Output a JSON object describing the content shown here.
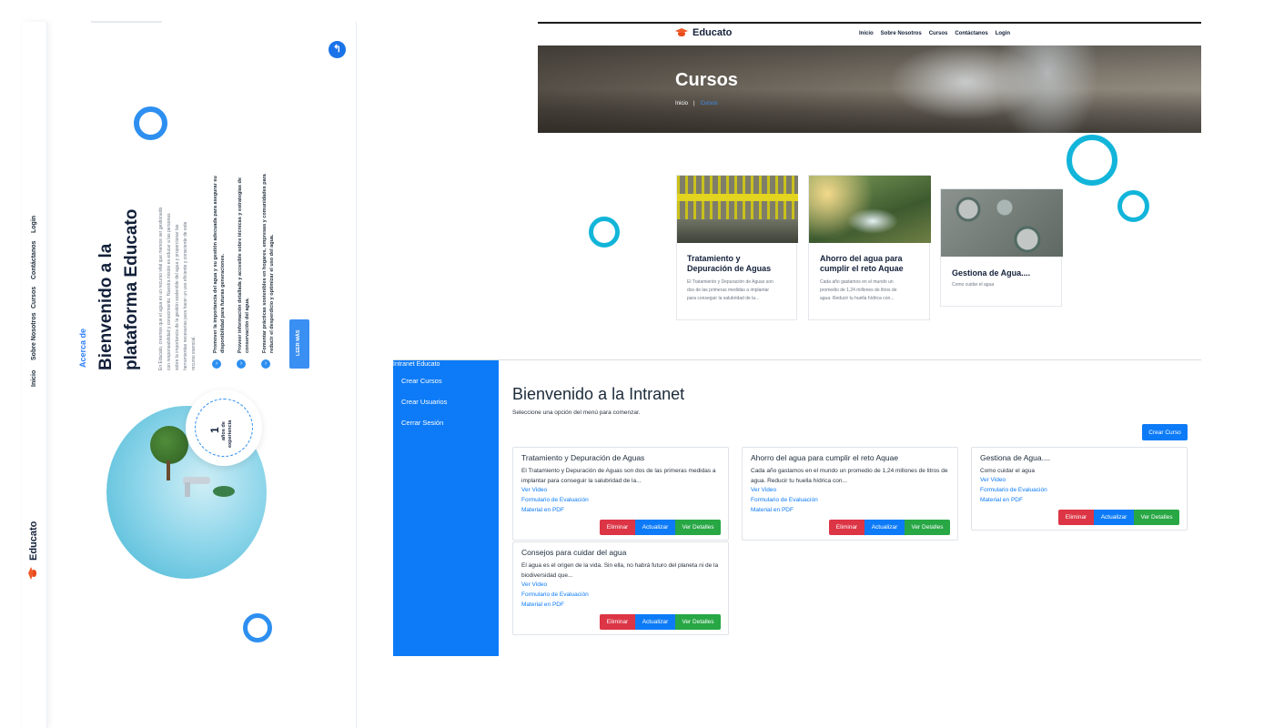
{
  "landing": {
    "nav": [
      "Inicio",
      "Sobre Nosotros",
      "Cursos",
      "Contáctanos",
      "Login"
    ],
    "logo": "Educato",
    "kicker": "Acerca de",
    "title_line1": "Bienvenido a la",
    "title_line2": "plataforma Educato",
    "paragraph": [
      "En Educato, creemos que el agua es un recurso vital que merece ser gestionado",
      "con responsabilidad y conocimiento. Nuestra misión es educar a las personas",
      "sobre la importancia de la gestión sostenible del agua y proporcionar las",
      "herramientas necesarias para hacer un uso eficiente y consciente de este",
      "recurso esencial."
    ],
    "bullets": [
      [
        "Promover la importancia del agua y su gestión adecuada para asegurar su",
        "disponibilidad para futuras generaciones."
      ],
      [
        "Proveer información detallada y accesible sobre técnicas y estrategias de",
        "conservación del agua."
      ],
      [
        "Fomentar prácticas sostenibles en hogares, empresas y comunidades para",
        "reducir el desperdicio y optimizar el uso del agua."
      ]
    ],
    "button": "LEER MÁS",
    "experience_number": "1",
    "experience_text_1": "años de",
    "experience_text_2": "experiencia",
    "accent": "#2d8ff0"
  },
  "cursos": {
    "logo": "Educato",
    "menu": [
      "Inicio",
      "Sobre Nosotros",
      "Cursos",
      "Contáctanos",
      "Login"
    ],
    "hero_title": "Cursos",
    "breadcrumb_home": "Inicio",
    "breadcrumb_sep": "|",
    "breadcrumb_current": "Cursos",
    "cards": [
      {
        "title_1": "Tratamiento y",
        "title_2": "Depuración de Aguas",
        "desc": [
          "El Tratamiento y Depuración de Aguas son",
          "dos de las primeras medidas a implantar",
          "para conseguir la salubridad de la..."
        ]
      },
      {
        "title_1": "Ahorro del agua para",
        "title_2": "cumplir el reto Aquae",
        "desc": [
          "Cada año gastamos en el mundo un",
          "promedio de 1,24 millones de litros de",
          "agua. Reducir tu huella hídrica con..."
        ]
      },
      {
        "title_1": "Gestiona de Agua....",
        "title_2": "",
        "desc": [
          "Como cuidar el agua"
        ]
      }
    ],
    "ring_color": "#12b5d9"
  },
  "intranet": {
    "brand": "Intranet Educato",
    "menu": [
      "Crear Cursos",
      "Crear Usuarios",
      "Cerrar Sesión"
    ],
    "heading": "Bienvenido a la Intranet",
    "subheading": "Seleccione una opción del menú para comenzar.",
    "create_button": "Crear Curso",
    "links": {
      "video": "Ver Video",
      "form": "Formulario de Evaluación",
      "pdf": "Material en PDF"
    },
    "buttons": {
      "delete": "Eliminar",
      "update": "Actualizar",
      "details": "Ver Detalles"
    },
    "cards": [
      {
        "title": "Tratamiento y Depuración de Aguas",
        "desc": "El Tratamiento y Depuración de Aguas son dos de las primeras medidas a implantar para conseguir la salubridad de la..."
      },
      {
        "title": "Ahorro del agua para cumplir el reto Aquae",
        "desc": "Cada año gastamos en el mundo un promedio de 1,24 millones de litros de agua. Reducir tu huella hídrica con..."
      },
      {
        "title": "Gestiona de Agua....",
        "desc": "Como cuidar el agua"
      },
      {
        "title": "Consejos para cuidar del agua",
        "desc": "El agua es el origen de la vida. Sin ella, no habrá futuro del planeta ni de la biodiversidad que..."
      }
    ],
    "colors": {
      "primary": "#0d7bf7",
      "danger": "#dc3545",
      "success": "#28a745"
    }
  }
}
